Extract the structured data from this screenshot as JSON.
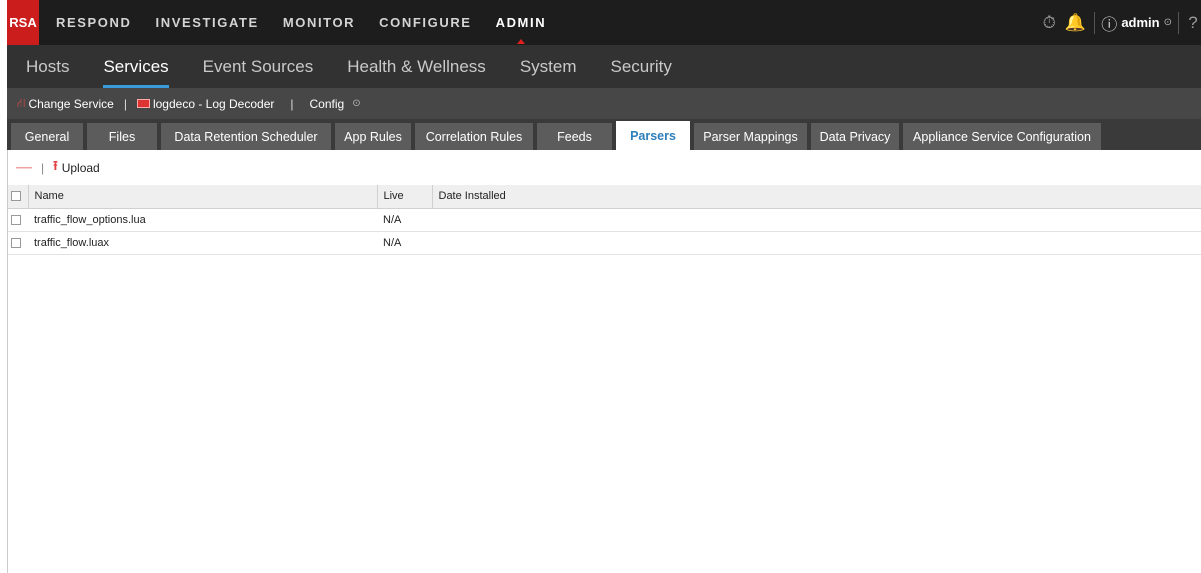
{
  "top": {
    "logo": "RSA",
    "nav": [
      "RESPOND",
      "INVESTIGATE",
      "MONITOR",
      "CONFIGURE",
      "ADMIN"
    ],
    "active_index": 4,
    "user": "admin"
  },
  "subnav": {
    "items": [
      "Hosts",
      "Services",
      "Event Sources",
      "Health & Wellness",
      "System",
      "Security"
    ],
    "active_index": 1
  },
  "service_bar": {
    "change_service": "Change Service",
    "service_name": "logdeco - Log Decoder",
    "view": "Config"
  },
  "tabs": {
    "items": [
      "General",
      "Files",
      "Data Retention Scheduler",
      "App Rules",
      "Correlation Rules",
      "Feeds",
      "Parsers",
      "Parser Mappings",
      "Data Privacy",
      "Appliance Service Configuration"
    ],
    "active_index": 6
  },
  "actions": {
    "upload": "Upload"
  },
  "table": {
    "headers": [
      "Name",
      "Live",
      "Date Installed"
    ],
    "rows": [
      {
        "name": "traffic_flow_options.lua",
        "live": "N/A",
        "date": ""
      },
      {
        "name": "traffic_flow.luax",
        "live": "N/A",
        "date": ""
      }
    ]
  },
  "colors": {
    "brand_red": "#cc1d1d",
    "accent_blue": "#3b9ad9",
    "active_tab_text": "#2d7fbb"
  }
}
